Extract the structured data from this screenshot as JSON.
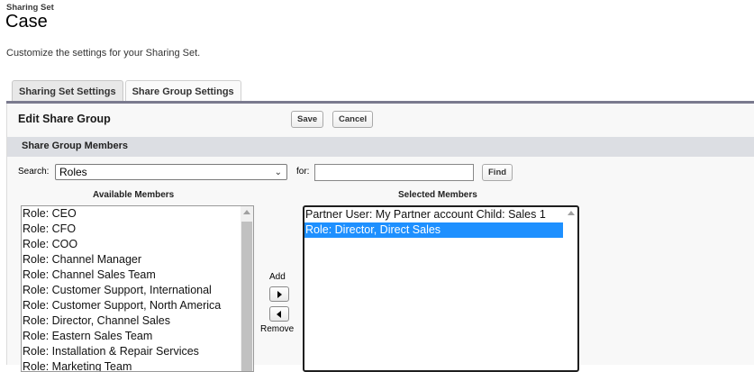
{
  "header": {
    "breadcrumb": "Sharing Set",
    "title": "Case",
    "description": "Customize the settings for your Sharing Set."
  },
  "tabs": [
    {
      "label": "Sharing Set Settings",
      "active": false
    },
    {
      "label": "Share Group Settings",
      "active": true
    }
  ],
  "panel": {
    "title": "Edit Share Group",
    "save_label": "Save",
    "cancel_label": "Cancel",
    "section_title": "Share Group Members"
  },
  "search": {
    "label": "Search:",
    "selected": "Roles",
    "for_label": "for:",
    "query": "",
    "find_label": "Find"
  },
  "available": {
    "header": "Available Members",
    "items": [
      "Role: CEO",
      "Role: CFO",
      "Role: COO",
      "Role: Channel Manager",
      "Role: Channel Sales Team",
      "Role: Customer Support, International",
      "Role: Customer Support, North America",
      "Role: Director, Channel Sales",
      "Role: Eastern Sales Team",
      "Role: Installation & Repair Services",
      "Role: Marketing Team"
    ]
  },
  "move": {
    "add_label": "Add",
    "remove_label": "Remove"
  },
  "selected_members": {
    "header": "Selected Members",
    "items": [
      "Partner User: My Partner account Child: Sales 1",
      "Role: Director, Direct Sales"
    ],
    "highlighted_index": 1
  }
}
